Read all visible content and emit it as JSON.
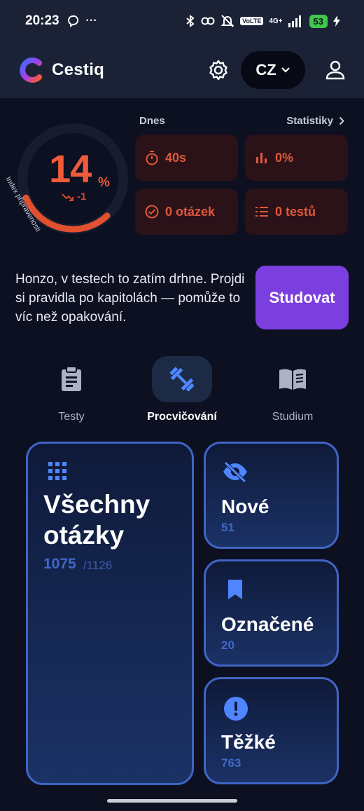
{
  "status_bar": {
    "time": "20:23",
    "network": "4G+",
    "volte": "VoLTE",
    "battery": "53"
  },
  "app": {
    "name": "Cestiq",
    "language": "CZ"
  },
  "readiness": {
    "percent": "14",
    "percent_sign": "%",
    "delta": "-1",
    "label": "Index připravenosti",
    "fill": 0.14
  },
  "today": {
    "title": "Dnes",
    "stats_link": "Statistiky",
    "time": "40s",
    "success": "0%",
    "questions": "0 otázek",
    "tests": "0 testů"
  },
  "tip": {
    "text": "Honzo, v testech to zatím drhne. Projdi si pravidla po kapitolách — pomůže to víc než opakování.",
    "button": "Studovat"
  },
  "tabs": [
    {
      "label": "Testy",
      "icon": "clipboard-icon",
      "active": false
    },
    {
      "label": "Procvičování",
      "icon": "dumbbell-icon",
      "active": true
    },
    {
      "label": "Studium",
      "icon": "book-icon",
      "active": false
    }
  ],
  "cards": {
    "all": {
      "title_line1": "Všechny",
      "title_line2": "otázky",
      "done": "1075",
      "total": "/1126",
      "icon": "grid-icon"
    },
    "new": {
      "title": "Nové",
      "count": "51",
      "icon": "eye-off-icon"
    },
    "marked": {
      "title": "Označené",
      "count": "20",
      "icon": "bookmark-icon"
    },
    "hard": {
      "title": "Těžké",
      "count": "763",
      "icon": "alert-icon"
    }
  },
  "colors": {
    "accent_red": "#ef5a3a",
    "accent_blue": "#3f64c4",
    "study_purple": "#7b3fe0",
    "bg": "#0c1020"
  }
}
